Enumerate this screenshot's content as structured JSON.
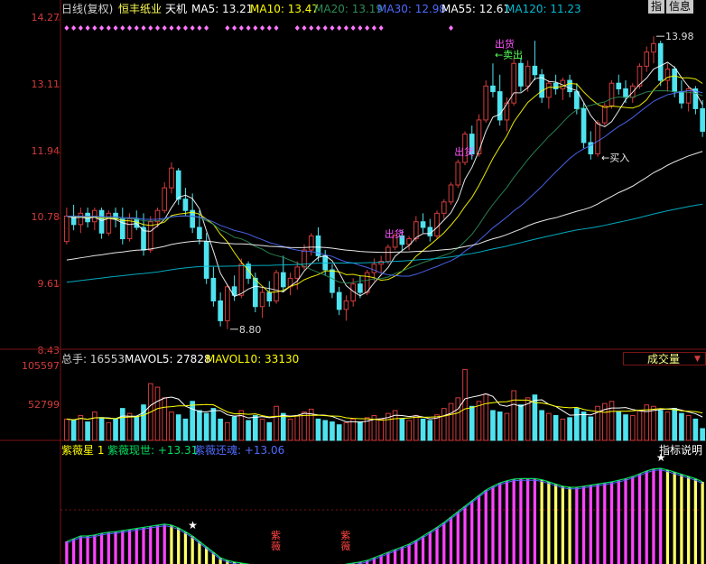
{
  "header": {
    "period_label": "日线(复权)",
    "stock_name": "恒丰纸业",
    "concept": "天机",
    "ma_items": [
      {
        "label": "MA5: 13.21",
        "color": "#ffffff"
      },
      {
        "label": "MA10: 13.47",
        "color": "#ffff00"
      },
      {
        "label": "MA20: 13.19",
        "color": "#2e8b57"
      },
      {
        "label": "MA30: 12.98",
        "color": "#4f6bff"
      },
      {
        "label": "MA55: 12.61",
        "color": "#ffffff"
      },
      {
        "label": "MA120: 11.23",
        "color": "#00bcd4"
      }
    ],
    "btn_zhi": "指",
    "btn_info": "信息"
  },
  "colors": {
    "up": "#d23c3c",
    "down": "#4fe3ef",
    "grid": "#7a1414",
    "axis_text": "#d23c3c",
    "diamond": "#ff77ff"
  },
  "price_axis": {
    "ticks": [
      "14.27",
      "13.11",
      "11.94",
      "10.78",
      "9.61",
      "8.43"
    ]
  },
  "volume_axis": {
    "ticks": [
      "105597",
      "52799"
    ]
  },
  "volume_panel": {
    "summary": "总手: 16553",
    "mavol5": "MAVOL5: 27828",
    "mavol10": "MAVOL10: 33130",
    "dropdown_label": "成交量",
    "dropdown_arrow": "▼"
  },
  "indicator_panel": {
    "title": "紫薇星 1",
    "line1": "紫薇现世: +13.31",
    "line2": "紫薇还魂: +13.06",
    "explain_button": "指标说明"
  },
  "annotations": {
    "high_label": "13.98",
    "low_label": "8.80",
    "buy_label": "买入",
    "sell_label": "卖出",
    "ship_label": "出货",
    "out1_label": "出货",
    "out2_label": "出货"
  },
  "chart_data": [
    {
      "type": "candlestick",
      "title": "恒丰纸业 日线(复权)",
      "ylim": [
        8.43,
        14.27
      ],
      "ohlc": [
        [
          10.35,
          10.95,
          10.3,
          10.8
        ],
        [
          10.8,
          11.0,
          10.55,
          10.65
        ],
        [
          10.65,
          10.95,
          10.5,
          10.85
        ],
        [
          10.85,
          10.95,
          10.6,
          10.7
        ],
        [
          10.7,
          10.95,
          10.55,
          10.9
        ],
        [
          10.9,
          10.95,
          10.4,
          10.5
        ],
        [
          10.5,
          10.9,
          10.45,
          10.85
        ],
        [
          10.85,
          10.95,
          10.6,
          10.75
        ],
        [
          10.75,
          10.95,
          10.3,
          10.4
        ],
        [
          10.4,
          10.85,
          10.35,
          10.75
        ],
        [
          10.75,
          10.9,
          10.55,
          10.6
        ],
        [
          10.6,
          10.85,
          10.1,
          10.2
        ],
        [
          10.2,
          10.8,
          10.15,
          10.7
        ],
        [
          10.7,
          10.95,
          10.6,
          10.9
        ],
        [
          10.9,
          11.4,
          10.85,
          11.3
        ],
        [
          11.3,
          11.75,
          11.2,
          11.65
        ],
        [
          11.6,
          11.65,
          11.0,
          11.1
        ],
        [
          11.1,
          11.3,
          10.8,
          10.9
        ],
        [
          10.9,
          11.2,
          10.5,
          10.6
        ],
        [
          10.6,
          10.9,
          10.3,
          10.4
        ],
        [
          10.35,
          10.5,
          9.6,
          9.7
        ],
        [
          9.7,
          9.9,
          9.2,
          9.3
        ],
        [
          9.3,
          9.45,
          8.85,
          8.95
        ],
        [
          8.95,
          9.6,
          8.8,
          9.55
        ],
        [
          9.55,
          9.75,
          9.3,
          9.4
        ],
        [
          9.4,
          10.05,
          9.35,
          9.95
        ],
        [
          9.95,
          10.0,
          9.6,
          9.7
        ],
        [
          9.7,
          9.8,
          9.1,
          9.2
        ],
        [
          9.2,
          9.55,
          9.0,
          9.45
        ],
        [
          9.45,
          9.65,
          9.2,
          9.3
        ],
        [
          9.3,
          9.85,
          9.25,
          9.8
        ],
        [
          9.8,
          10.1,
          9.45,
          9.55
        ],
        [
          9.55,
          9.8,
          9.4,
          9.7
        ],
        [
          9.7,
          10.0,
          9.5,
          9.9
        ],
        [
          9.9,
          10.3,
          9.85,
          10.2
        ],
        [
          10.2,
          10.5,
          10.1,
          10.45
        ],
        [
          10.45,
          10.6,
          10.0,
          10.1
        ],
        [
          10.1,
          10.2,
          9.75,
          9.85
        ],
        [
          9.85,
          9.95,
          9.35,
          9.45
        ],
        [
          9.45,
          9.55,
          9.05,
          9.15
        ],
        [
          9.15,
          9.4,
          8.95,
          9.3
        ],
        [
          9.3,
          9.7,
          9.2,
          9.6
        ],
        [
          9.6,
          9.75,
          9.35,
          9.45
        ],
        [
          9.45,
          9.85,
          9.4,
          9.8
        ],
        [
          9.8,
          10.05,
          9.65,
          9.95
        ],
        [
          9.95,
          10.1,
          9.8,
          10.0
        ],
        [
          10.0,
          10.3,
          9.95,
          10.25
        ],
        [
          10.25,
          10.5,
          10.2,
          10.45
        ],
        [
          10.45,
          10.55,
          10.2,
          10.3
        ],
        [
          10.3,
          10.45,
          10.2,
          10.4
        ],
        [
          10.4,
          10.8,
          10.35,
          10.7
        ],
        [
          10.7,
          10.85,
          10.5,
          10.6
        ],
        [
          10.6,
          10.75,
          10.35,
          10.45
        ],
        [
          10.45,
          10.9,
          10.4,
          10.85
        ],
        [
          10.85,
          11.1,
          10.75,
          11.05
        ],
        [
          11.05,
          11.4,
          11.0,
          11.35
        ],
        [
          11.35,
          11.8,
          11.3,
          11.75
        ],
        [
          11.75,
          12.3,
          11.7,
          12.25
        ],
        [
          12.25,
          12.4,
          11.8,
          11.9
        ],
        [
          11.9,
          12.6,
          11.85,
          12.5
        ],
        [
          12.5,
          13.2,
          12.45,
          13.1
        ],
        [
          13.1,
          13.5,
          12.9,
          13.0
        ],
        [
          13.0,
          13.3,
          12.4,
          12.5
        ],
        [
          12.5,
          12.9,
          12.3,
          12.8
        ],
        [
          12.8,
          13.6,
          12.75,
          13.5
        ],
        [
          13.5,
          13.6,
          13.0,
          13.1
        ],
        [
          13.1,
          13.55,
          13.0,
          13.45
        ],
        [
          13.45,
          13.9,
          13.2,
          13.3
        ],
        [
          13.3,
          13.4,
          12.8,
          12.9
        ],
        [
          12.9,
          13.2,
          12.7,
          13.15
        ],
        [
          13.15,
          13.3,
          12.95,
          13.05
        ],
        [
          13.05,
          13.25,
          12.85,
          13.2
        ],
        [
          13.2,
          13.3,
          12.9,
          13.0
        ],
        [
          13.0,
          13.15,
          12.6,
          12.7
        ],
        [
          12.7,
          12.8,
          12.0,
          12.1
        ],
        [
          12.1,
          12.3,
          11.8,
          11.9
        ],
        [
          11.9,
          12.5,
          11.85,
          12.45
        ],
        [
          12.45,
          12.8,
          12.4,
          12.75
        ],
        [
          12.75,
          13.2,
          12.7,
          13.15
        ],
        [
          13.15,
          13.3,
          12.95,
          13.05
        ],
        [
          13.05,
          13.2,
          12.8,
          12.9
        ],
        [
          12.9,
          13.15,
          12.8,
          13.1
        ],
        [
          13.1,
          13.5,
          13.05,
          13.45
        ],
        [
          13.45,
          13.8,
          13.35,
          13.7
        ],
        [
          13.7,
          13.98,
          13.5,
          13.85
        ],
        [
          13.85,
          13.9,
          13.1,
          13.2
        ],
        [
          13.2,
          13.5,
          13.0,
          13.4
        ],
        [
          13.4,
          13.45,
          12.9,
          13.0
        ],
        [
          13.0,
          13.2,
          12.7,
          12.8
        ],
        [
          12.8,
          13.1,
          12.65,
          13.05
        ],
        [
          13.05,
          13.1,
          12.6,
          12.7
        ],
        [
          12.7,
          12.85,
          12.2,
          12.3
        ]
      ],
      "ma_series": [
        {
          "name": "MA5",
          "color": "#ffffff"
        },
        {
          "name": "MA10",
          "color": "#ffff00"
        },
        {
          "name": "MA20",
          "color": "#2e8b57"
        },
        {
          "name": "MA30",
          "color": "#4f6bff"
        },
        {
          "name": "MA55",
          "color": "#ffffff"
        },
        {
          "name": "MA120",
          "color": "#00bcd4"
        }
      ],
      "markers": {
        "high": 13.98,
        "low": 8.8
      }
    },
    {
      "type": "bar",
      "title": "成交量",
      "ylim": [
        0,
        105597
      ],
      "values": [
        30000,
        28000,
        35000,
        26000,
        40000,
        32000,
        25000,
        30000,
        45000,
        38000,
        33000,
        50000,
        80000,
        75000,
        60000,
        40000,
        36000,
        30000,
        55000,
        42000,
        38000,
        45000,
        30000,
        25000,
        33000,
        42000,
        28000,
        35000,
        30000,
        25000,
        48000,
        38000,
        30000,
        35000,
        40000,
        44000,
        30000,
        28000,
        26000,
        22000,
        25000,
        30000,
        26000,
        32000,
        35000,
        30000,
        38000,
        42000,
        30000,
        28000,
        35000,
        30000,
        28000,
        36000,
        45000,
        52000,
        60000,
        100000,
        48000,
        55000,
        65000,
        42000,
        40000,
        38000,
        70000,
        50000,
        60000,
        64000,
        42000,
        38000,
        35000,
        30000,
        32000,
        45000,
        40000,
        33000,
        48000,
        52000,
        55000,
        40000,
        36000,
        35000,
        42000,
        50000,
        48000,
        42000,
        40000,
        45000,
        38000,
        35000,
        30000,
        16553
      ],
      "mavol": [
        {
          "name": "MAVOL5",
          "color": "#ffffff"
        },
        {
          "name": "MAVOL10",
          "color": "#ffff00"
        }
      ]
    },
    {
      "type": "area",
      "title": "紫薇星 1",
      "values": [
        0.2,
        0.25,
        0.3,
        0.3,
        0.32,
        0.35,
        0.37,
        0.38,
        0.4,
        0.42,
        0.44,
        0.46,
        0.48,
        0.5,
        0.52,
        0.5,
        0.45,
        0.38,
        0.3,
        0.2,
        0.1,
        0.0,
        -0.1,
        -0.15,
        -0.18,
        -0.2,
        -0.22,
        -0.24,
        -0.25,
        -0.26,
        -0.27,
        -0.28,
        -0.29,
        -0.3,
        -0.31,
        -0.32,
        -0.3,
        -0.28,
        -0.26,
        -0.25,
        -0.22,
        -0.2,
        -0.18,
        -0.15,
        -0.1,
        -0.05,
        0.0,
        0.05,
        0.1,
        0.15,
        0.22,
        0.3,
        0.38,
        0.46,
        0.55,
        0.65,
        0.75,
        0.85,
        0.95,
        1.05,
        1.15,
        1.22,
        1.28,
        1.32,
        1.35,
        1.36,
        1.36,
        1.36,
        1.34,
        1.3,
        1.26,
        1.22,
        1.2,
        1.2,
        1.22,
        1.24,
        1.26,
        1.28,
        1.3,
        1.33,
        1.36,
        1.4,
        1.45,
        1.5,
        1.54,
        1.55,
        1.52,
        1.48,
        1.44,
        1.4,
        1.36,
        1.3
      ],
      "stars": [
        18,
        85
      ],
      "labels": [
        {
          "index": 30,
          "text": "紫薇"
        },
        {
          "index": 40,
          "text": "紫薇"
        }
      ]
    }
  ]
}
